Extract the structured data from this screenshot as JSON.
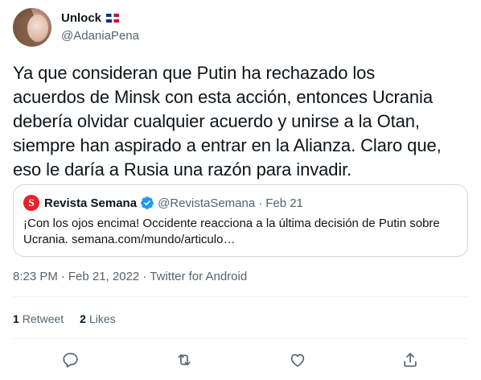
{
  "author": {
    "display_name": "Unlock",
    "flag": "dominican-republic-flag",
    "handle": "@AdaniaPena"
  },
  "tweet": {
    "lines": [
      "Ya que consideran que Putin ha rechazado los",
      "acuerdos de Minsk con esta acción, entonces Ucrania",
      "debería olvidar cualquier acuerdo y unirse a la Otan,",
      "siempre han aspirado a entrar en la Alianza. Claro que,",
      "eso le daría a Rusia una razón para invadir."
    ]
  },
  "quote": {
    "logo_letter": "S",
    "name": "Revista Semana",
    "handle": "@RevistaSemana",
    "separator": "·",
    "date": "Feb 21",
    "text_line1": "¡Con los ojos encima! Occidente reacciona a la última decisión de Putin sobre",
    "text_line2": "Ucrania. semana.com/mundo/articulo…"
  },
  "meta": {
    "time": "8:23 PM",
    "separator": "·",
    "date": "Feb 21, 2022",
    "source": "Twitter for Android"
  },
  "stats": {
    "retweets_count": "1",
    "retweets_label": "Retweet",
    "likes_count": "2",
    "likes_label": "Likes"
  },
  "colors": {
    "text": "#0f1419",
    "secondary": "#536471",
    "verified": "#1d9bf0",
    "border": "#cfd9de",
    "semana_red": "#e3242b"
  },
  "actions": [
    "reply-icon",
    "retweet-icon",
    "like-icon",
    "share-icon"
  ]
}
